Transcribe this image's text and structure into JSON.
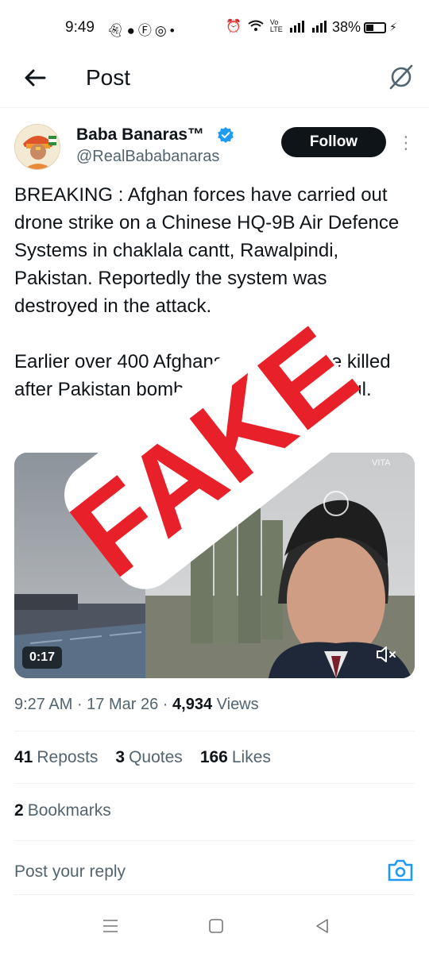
{
  "status_bar": {
    "time": "9:49",
    "notif_icons": [
      "snapchat-icon",
      "messenger-icon",
      "facebook-icon",
      "whatsapp-icon",
      "dot-icon"
    ],
    "network_label": "Vo LTE",
    "battery": "38%"
  },
  "header": {
    "title": "Post"
  },
  "author": {
    "name": "Baba Banaras™",
    "handle": "@RealBababanaras",
    "follow_label": "Follow",
    "verified": true
  },
  "post": {
    "paragraphs": [
      "BREAKING : Afghan forces have carried out drone strike on a Chinese HQ-9B Air Defence Systems in chaklala cantt, Rawalpindi, Pakistan. Reportedly the system was destroyed in the attack.",
      "Earlier over 400 Afghans civilians were killed after Pakistan bombed a hospital in Kabul."
    ]
  },
  "media": {
    "duration": "0:17",
    "watermark": "VITA",
    "overlay_stamp": "FAKE"
  },
  "meta": {
    "time": "9:27 AM",
    "date": "17 Mar 26",
    "views_count": "4,934",
    "views_label": "Views"
  },
  "stats": {
    "reposts_count": "41",
    "reposts_label": "Reposts",
    "quotes_count": "3",
    "quotes_label": "Quotes",
    "likes_count": "166",
    "likes_label": "Likes"
  },
  "bookmarks": {
    "count": "2",
    "label": "Bookmarks"
  },
  "reply": {
    "placeholder": "Post your reply"
  },
  "colors": {
    "text": "#0f1419",
    "secondary": "#536471",
    "accent": "#1d9bf0",
    "stamp": "#e8202a"
  }
}
